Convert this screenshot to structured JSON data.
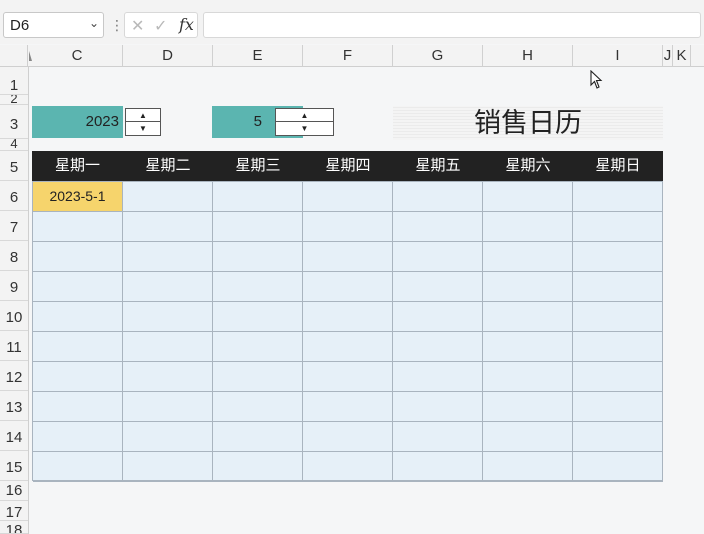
{
  "formula_bar": {
    "name_box": "D6",
    "dropdown_glyph": "⌄",
    "separator": "⋮",
    "cancel_glyph": "✕",
    "enter_glyph": "✓",
    "fx_label": "fx",
    "formula": ""
  },
  "columns": [
    {
      "id": "c-col-c",
      "label": "C"
    },
    {
      "id": "c-col-d",
      "label": "D"
    },
    {
      "id": "c-col-e",
      "label": "E"
    },
    {
      "id": "c-col-f",
      "label": "F"
    },
    {
      "id": "c-col-g",
      "label": "G"
    },
    {
      "id": "c-col-h",
      "label": "H"
    },
    {
      "id": "c-col-i",
      "label": "I"
    },
    {
      "id": "c-col-j",
      "label": "J"
    },
    {
      "id": "c-col-k",
      "label": "K"
    }
  ],
  "rows": [
    "1",
    "2",
    "3",
    "4",
    "5",
    "6",
    "7",
    "8",
    "9",
    "10",
    "11",
    "12",
    "13",
    "14",
    "15",
    "16",
    "17",
    "18"
  ],
  "controls": {
    "year": "2023",
    "month": "5",
    "spin_up": "▲",
    "spin_down": "▼"
  },
  "title": "销售日历",
  "calendar": {
    "weekdays": [
      "星期一",
      "星期二",
      "星期三",
      "星期四",
      "星期五",
      "星期六",
      "星期日"
    ],
    "cells": [
      [
        "2023-5-1",
        "",
        "",
        "",
        "",
        "",
        ""
      ],
      [
        "",
        "",
        "",
        "",
        "",
        "",
        ""
      ],
      [
        "",
        "",
        "",
        "",
        "",
        "",
        ""
      ],
      [
        "",
        "",
        "",
        "",
        "",
        "",
        ""
      ],
      [
        "",
        "",
        "",
        "",
        "",
        "",
        ""
      ],
      [
        "",
        "",
        "",
        "",
        "",
        "",
        ""
      ],
      [
        "",
        "",
        "",
        "",
        "",
        "",
        ""
      ],
      [
        "",
        "",
        "",
        "",
        "",
        "",
        ""
      ],
      [
        "",
        "",
        "",
        "",
        "",
        "",
        ""
      ],
      [
        "",
        "",
        "",
        "",
        "",
        "",
        ""
      ]
    ],
    "highlight_color": "#f6d46c",
    "header_color": "#222222",
    "grid_color": "#e6f0f8"
  },
  "accent_color": "#5bb5b0",
  "cursor_icon": "mouse-pointer-icon"
}
